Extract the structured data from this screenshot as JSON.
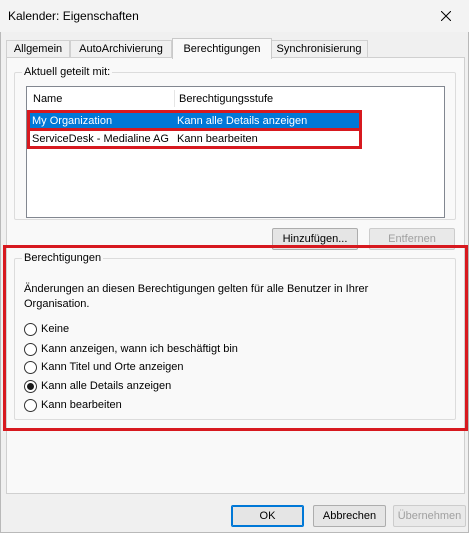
{
  "window": {
    "title": "Kalender: Eigenschaften"
  },
  "tabs": [
    {
      "label": "Allgemein"
    },
    {
      "label": "AutoArchivierung"
    },
    {
      "label": "Berechtigungen"
    },
    {
      "label": "Synchronisierung"
    }
  ],
  "shared": {
    "group_label": "Aktuell geteilt mit:",
    "columns": [
      "Name",
      "Berechtigungsstufe"
    ],
    "rows": [
      {
        "name": "My Organization",
        "level": "Kann alle Details anzeigen",
        "selected": true
      },
      {
        "name": "ServiceDesk - Medialine AG",
        "level": "Kann bearbeiten",
        "selected": false
      }
    ],
    "add_button": "Hinzufügen...",
    "remove_button": "Entfernen"
  },
  "permissions": {
    "group_label": "Berechtigungen",
    "info": "Änderungen an diesen Berechtigungen gelten für alle Benutzer in Ihrer Organisation.",
    "options": [
      {
        "label": "Keine",
        "checked": false
      },
      {
        "label": "Kann anzeigen, wann ich beschäftigt bin",
        "checked": false
      },
      {
        "label": "Kann Titel und Orte anzeigen",
        "checked": false
      },
      {
        "label": "Kann alle Details anzeigen",
        "checked": true
      },
      {
        "label": "Kann bearbeiten",
        "checked": false
      }
    ]
  },
  "footer": {
    "ok": "OK",
    "cancel": "Abbrechen",
    "apply": "Übernehmen"
  },
  "colors": {
    "selection": "#0078d7",
    "highlight_box": "#d7191f"
  }
}
